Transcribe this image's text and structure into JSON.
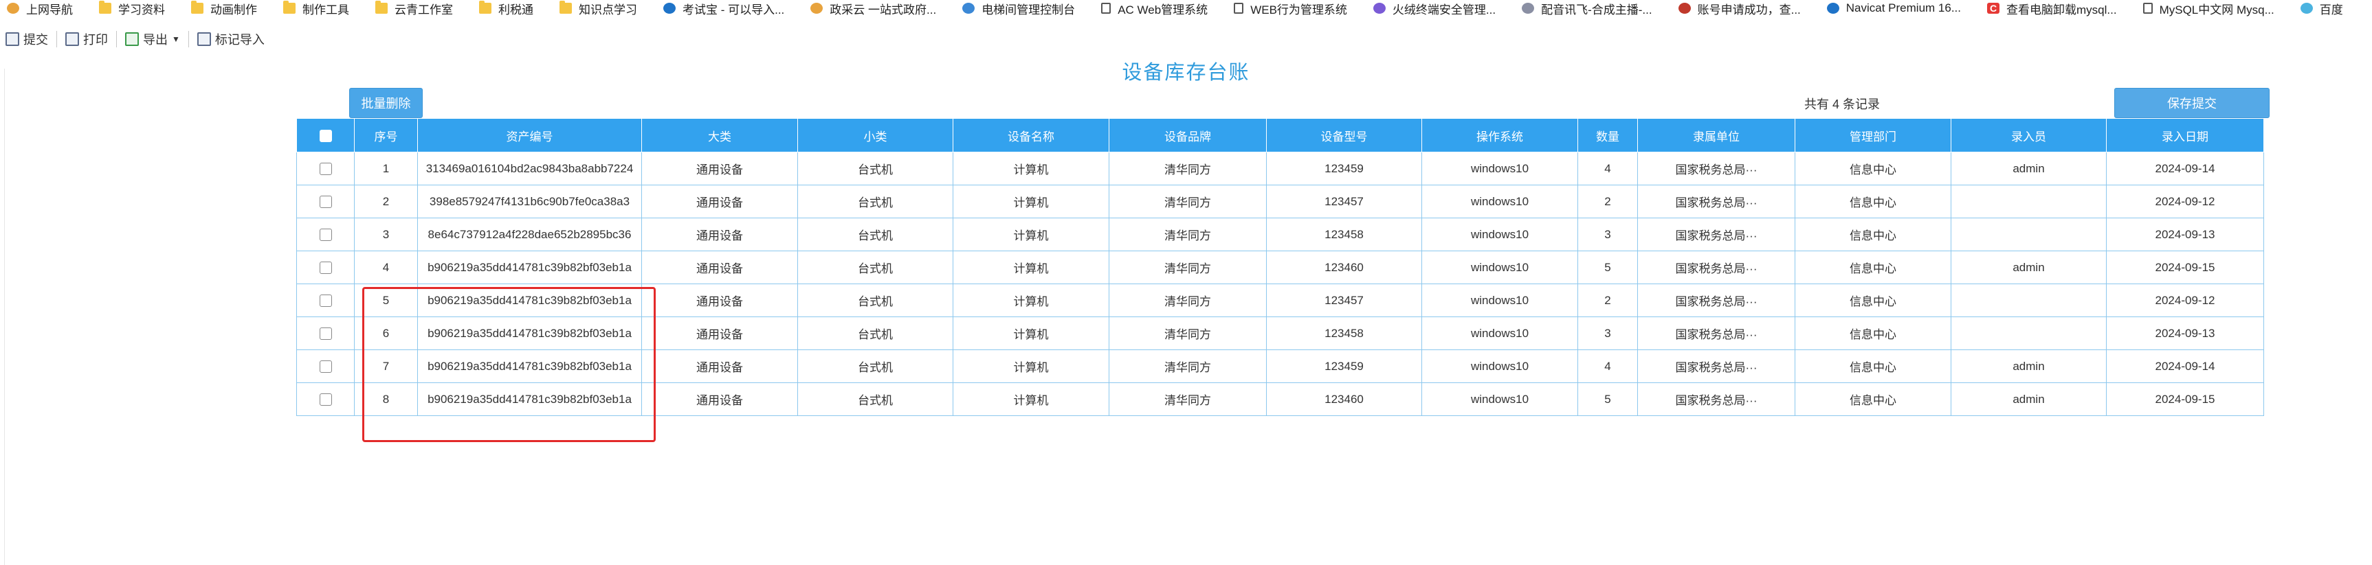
{
  "bookmarks": [
    {
      "label": "上网导航",
      "icon": "chrome-icon"
    },
    {
      "label": "学习资料",
      "icon": "folder-icon"
    },
    {
      "label": "动画制作",
      "icon": "folder-icon"
    },
    {
      "label": "制作工具",
      "icon": "folder-icon"
    },
    {
      "label": "云青工作室",
      "icon": "folder-icon"
    },
    {
      "label": "利税通",
      "icon": "folder-icon"
    },
    {
      "label": "知识点学习",
      "icon": "folder-icon"
    },
    {
      "label": "考试宝 - 可以导入...",
      "icon": "globe-icon"
    },
    {
      "label": "政采云 一站式政府...",
      "icon": "star-icon"
    },
    {
      "label": "电梯间管理控制台",
      "icon": "cloud-icon"
    },
    {
      "label": "AC Web管理系统",
      "icon": "page-icon"
    },
    {
      "label": "WEB行为管理系统",
      "icon": "page-icon"
    },
    {
      "label": "火绒终端安全管理...",
      "icon": "flame-icon"
    },
    {
      "label": "配音讯飞-合成主播-...",
      "icon": "mic-icon"
    },
    {
      "label": "账号申请成功，查...",
      "icon": "infinity-icon"
    },
    {
      "label": "Navicat Premium 16...",
      "icon": "navicat-icon"
    },
    {
      "label": "查看电脑卸载mysql...",
      "icon": "c-icon"
    },
    {
      "label": "MySQL中文网 Mysq...",
      "icon": "page-icon"
    },
    {
      "label": "百度",
      "icon": "translate-icon"
    }
  ],
  "toolbar": {
    "submit": "提交",
    "print": "打印",
    "export": "导出",
    "import": "标记导入"
  },
  "title": "设备库存台账",
  "batch_delete": "批量删除",
  "record_count": "共有 4 条记录",
  "save_submit": "保存提交",
  "table": {
    "headers": [
      "序号",
      "资产编号",
      "大类",
      "小类",
      "设备名称",
      "设备品牌",
      "设备型号",
      "操作系统",
      "数量",
      "隶属单位",
      "管理部门",
      "录入员",
      "录入日期"
    ],
    "rows": [
      [
        "1",
        "313469a016104bd2ac9843ba8abb7224",
        "通用设备",
        "台式机",
        "计算机",
        "清华同方",
        "123459",
        "windows10",
        "4",
        "国家税务总局···",
        "信息中心",
        "admin",
        "2024-09-14"
      ],
      [
        "2",
        "398e8579247f4131b6c90b7fe0ca38a3",
        "通用设备",
        "台式机",
        "计算机",
        "清华同方",
        "123457",
        "windows10",
        "2",
        "国家税务总局···",
        "信息中心",
        "",
        "2024-09-12"
      ],
      [
        "3",
        "8e64c737912a4f228dae652b2895bc36",
        "通用设备",
        "台式机",
        "计算机",
        "清华同方",
        "123458",
        "windows10",
        "3",
        "国家税务总局···",
        "信息中心",
        "",
        "2024-09-13"
      ],
      [
        "4",
        "b906219a35dd414781c39b82bf03eb1a",
        "通用设备",
        "台式机",
        "计算机",
        "清华同方",
        "123460",
        "windows10",
        "5",
        "国家税务总局···",
        "信息中心",
        "admin",
        "2024-09-15"
      ],
      [
        "5",
        "b906219a35dd414781c39b82bf03eb1a",
        "通用设备",
        "台式机",
        "计算机",
        "清华同方",
        "123457",
        "windows10",
        "2",
        "国家税务总局···",
        "信息中心",
        "",
        "2024-09-12"
      ],
      [
        "6",
        "b906219a35dd414781c39b82bf03eb1a",
        "通用设备",
        "台式机",
        "计算机",
        "清华同方",
        "123458",
        "windows10",
        "3",
        "国家税务总局···",
        "信息中心",
        "",
        "2024-09-13"
      ],
      [
        "7",
        "b906219a35dd414781c39b82bf03eb1a",
        "通用设备",
        "台式机",
        "计算机",
        "清华同方",
        "123459",
        "windows10",
        "4",
        "国家税务总局···",
        "信息中心",
        "admin",
        "2024-09-14"
      ],
      [
        "8",
        "b906219a35dd414781c39b82bf03eb1a",
        "通用设备",
        "台式机",
        "计算机",
        "清华同方",
        "123460",
        "windows10",
        "5",
        "国家税务总局···",
        "信息中心",
        "admin",
        "2024-09-15"
      ]
    ]
  },
  "colors": {
    "header_bg": "#33a2ee",
    "title": "#2f9bdc",
    "highlight": "#e32a2a"
  }
}
